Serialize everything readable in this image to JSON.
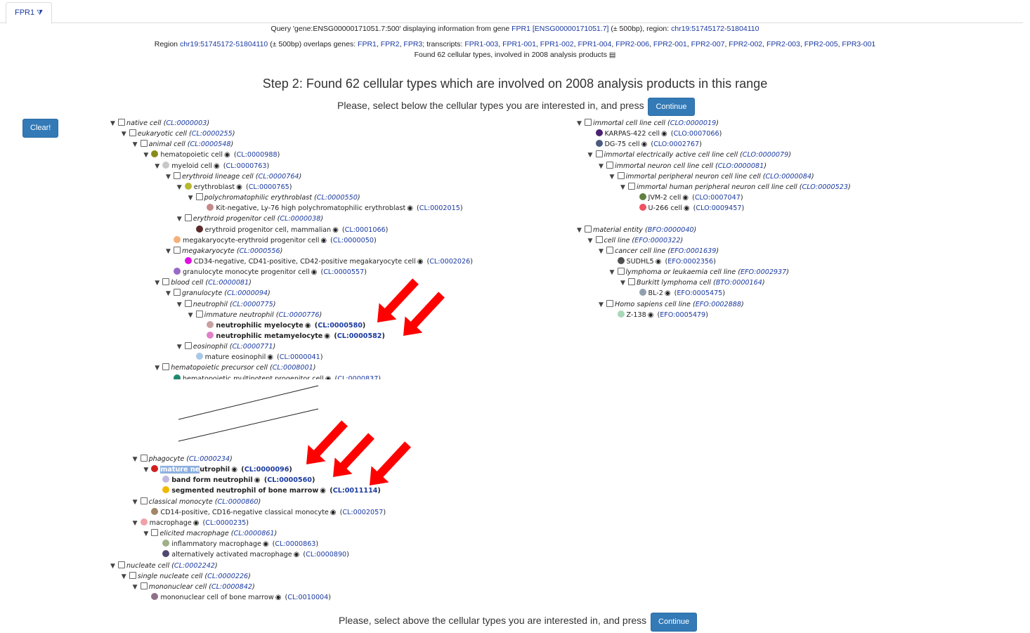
{
  "tab": {
    "label": "FPR1",
    "icon": "filter-icon"
  },
  "header": {
    "line1": {
      "prefix": "Query 'gene:ENSG00000171051.7:500' displaying information from gene ",
      "gene": "FPR1 [ENSG00000171051.7]",
      "mid": " (± 500bp), region: ",
      "region": "chr19:51745172-51804110"
    },
    "line2": {
      "prefix": "Region ",
      "region": "chr19:51745172-51804110",
      "mid": " (± 500bp) overlaps genes: ",
      "genes": [
        "FPR1",
        "FPR2",
        "FPR3"
      ],
      "tlabel": "; transcripts: ",
      "transcripts": [
        "FPR1-003",
        "FPR1-001",
        "FPR1-002",
        "FPR1-004",
        "FPR2-006",
        "FPR2-001",
        "FPR2-007",
        "FPR2-002",
        "FPR2-003",
        "FPR2-005",
        "FPR3-001"
      ]
    },
    "line3": "Found 62 cellular types, involved in 2008 analysis products"
  },
  "step_title": "Step 2: Found 62 cellular types which are involved on 2008 analysis products in this range",
  "top_prompt": "Please, select below the cellular types you are interested in, and press",
  "bottom_prompt": "Please, select above the cellular types you are interested in, and press",
  "continue_label": "Continue",
  "clear_label": "Clear!",
  "tree_left_top": [
    {
      "d": 0,
      "tri": true,
      "cb": true,
      "name": "native cell",
      "id": "CL:0000003",
      "style": "it"
    },
    {
      "d": 1,
      "tri": true,
      "cb": true,
      "name": "eukaryotic cell",
      "id": "CL:0000255",
      "style": "it"
    },
    {
      "d": 2,
      "tri": true,
      "cb": true,
      "name": "animal cell",
      "id": "CL:0000548",
      "style": "it"
    },
    {
      "d": 3,
      "tri": true,
      "dot": "#8a8a1a",
      "name": "hematopoietic cell",
      "id": "CL:0000988",
      "eye": true
    },
    {
      "d": 4,
      "tri": true,
      "dot": "#c8c8c8",
      "name": "myeloid cell",
      "id": "CL:0000763",
      "eye": true
    },
    {
      "d": 5,
      "tri": true,
      "cb": true,
      "name": "erythroid lineage cell",
      "id": "CL:0000764",
      "style": "it"
    },
    {
      "d": 6,
      "tri": true,
      "dot": "#b8b830",
      "name": "erythroblast",
      "id": "CL:0000765",
      "eye": true
    },
    {
      "d": 7,
      "tri": true,
      "cb": true,
      "name": "polychromatophilic erythroblast",
      "id": "CL:0000550",
      "style": "it"
    },
    {
      "d": 8,
      "dot": "#c48a8a",
      "name": "Kit-negative, Ly-76 high polychromatophilic erythroblast",
      "id": "CL:0002015",
      "eye": true
    },
    {
      "d": 6,
      "tri": true,
      "cb": true,
      "name": "erythroid progenitor cell",
      "id": "CL:0000038",
      "style": "it"
    },
    {
      "d": 7,
      "dot": "#5a2a2a",
      "name": "erythroid progenitor cell, mammalian",
      "id": "CL:0001066",
      "eye": true
    },
    {
      "d": 5,
      "dot": "#f5b07a",
      "name": "megakaryocyte-erythroid progenitor cell",
      "id": "CL:0000050",
      "eye": true
    },
    {
      "d": 5,
      "tri": true,
      "cb": true,
      "name": "megakaryocyte",
      "id": "CL:0000556",
      "style": "it"
    },
    {
      "d": 6,
      "dot": "#e010e0",
      "name": "CD34-negative, CD41-positive, CD42-positive megakaryocyte cell",
      "id": "CL:0002026",
      "eye": true
    },
    {
      "d": 5,
      "dot": "#9a6ac8",
      "name": "granulocyte monocyte progenitor cell",
      "id": "CL:0000557",
      "eye": true
    },
    {
      "d": 4,
      "tri": true,
      "cb": true,
      "name": "blood cell",
      "id": "CL:0000081",
      "style": "it"
    },
    {
      "d": 5,
      "tri": true,
      "cb": true,
      "name": "granulocyte",
      "id": "CL:0000094",
      "style": "it"
    },
    {
      "d": 6,
      "tri": true,
      "cb": true,
      "name": "neutrophil",
      "id": "CL:0000775",
      "style": "it"
    },
    {
      "d": 7,
      "tri": true,
      "cb": true,
      "name": "immature neutrophil",
      "id": "CL:0000776",
      "style": "it"
    },
    {
      "d": 8,
      "dot": "#c8a0a0",
      "name": "neutrophilic myelocyte",
      "id": "CL:0000580",
      "eye": true,
      "style": "b"
    },
    {
      "d": 8,
      "dot": "#e080c8",
      "name": "neutrophilic metamyelocyte",
      "id": "CL:0000582",
      "eye": true,
      "style": "b"
    },
    {
      "d": 6,
      "tri": true,
      "cb": true,
      "name": "eosinophil",
      "id": "CL:0000771",
      "style": "it"
    },
    {
      "d": 7,
      "dot": "#a8c8e8",
      "name": "mature eosinophil",
      "id": "CL:0000041",
      "eye": true
    },
    {
      "d": 4,
      "tri": true,
      "cb": true,
      "name": "hematopoietic precursor cell",
      "id": "CL:0008001",
      "style": "it"
    },
    {
      "d": 5,
      "dot": "#208870",
      "name": "hematopoietic multipotent progenitor cell",
      "id": "CL:0000837",
      "eye": true
    }
  ],
  "tree_left_bottom": [
    {
      "d": 2,
      "tri": true,
      "cb": true,
      "name": "phagocyte",
      "id": "CL:0000234",
      "style": "it"
    },
    {
      "d": 3,
      "tri": true,
      "dot": "#d02020",
      "name": "mature neutrophil",
      "sel": "mature ne",
      "id": "CL:0000096",
      "eye": true,
      "style": "b"
    },
    {
      "d": 4,
      "dot": "#c0b8e0",
      "name": "band form neutrophil",
      "id": "CL:0000560",
      "eye": true,
      "style": "b"
    },
    {
      "d": 4,
      "dot": "#f0b800",
      "name": "segmented neutrophil of bone marrow",
      "id": "CL:0011114",
      "eye": true,
      "style": "b"
    },
    {
      "d": 2,
      "tri": true,
      "cb": true,
      "name": "classical monocyte",
      "id": "CL:0000860",
      "style": "it"
    },
    {
      "d": 3,
      "dot": "#a08868",
      "name": "CD14-positive, CD16-negative classical monocyte",
      "id": "CL:0002057",
      "eye": true
    },
    {
      "d": 2,
      "tri": true,
      "dot": "#f0a0a8",
      "name": "macrophage",
      "id": "CL:0000235",
      "eye": true
    },
    {
      "d": 3,
      "tri": true,
      "cb": true,
      "name": "elicited macrophage",
      "id": "CL:0000861",
      "style": "it"
    },
    {
      "d": 4,
      "dot": "#a0b088",
      "name": "inflammatory macrophage",
      "id": "CL:0000863",
      "eye": true
    },
    {
      "d": 4,
      "dot": "#504870",
      "name": "alternatively activated macrophage",
      "id": "CL:0000890",
      "eye": true
    },
    {
      "d": 0,
      "tri": true,
      "cb": true,
      "name": "nucleate cell",
      "id": "CL:0002242",
      "style": "it"
    },
    {
      "d": 1,
      "tri": true,
      "cb": true,
      "name": "single nucleate cell",
      "id": "CL:0000226",
      "style": "it"
    },
    {
      "d": 2,
      "tri": true,
      "cb": true,
      "name": "mononuclear cell",
      "id": "CL:0000842",
      "style": "it"
    },
    {
      "d": 3,
      "dot": "#907088",
      "name": "mononuclear cell of bone marrow",
      "id": "CL:0010004",
      "eye": true
    }
  ],
  "tree_right": [
    {
      "d": 0,
      "tri": true,
      "cb": true,
      "name": "immortal cell line cell",
      "id": "CLO:0000019",
      "style": "it"
    },
    {
      "d": 1,
      "dot": "#4a2070",
      "name": "KARPAS-422 cell",
      "id": "CLO:0007066",
      "eye": true
    },
    {
      "d": 1,
      "dot": "#4a5a80",
      "name": "DG-75 cell",
      "id": "CLO:0002767",
      "eye": true
    },
    {
      "d": 1,
      "tri": true,
      "cb": true,
      "name": "immortal electrically active cell line cell",
      "id": "CLO:0000079",
      "style": "it"
    },
    {
      "d": 2,
      "tri": true,
      "cb": true,
      "name": "immortal neuron cell line cell",
      "id": "CLO:0000081",
      "style": "it"
    },
    {
      "d": 3,
      "tri": true,
      "cb": true,
      "name": "immortal peripheral neuron cell line cell",
      "id": "CLO:0000084",
      "style": "it"
    },
    {
      "d": 4,
      "tri": true,
      "cb": true,
      "name": "immortal human peripheral neuron cell line cell",
      "id": "CLO:0000523",
      "style": "it"
    },
    {
      "d": 5,
      "dot": "#608040",
      "name": "JVM-2 cell",
      "id": "CLO:0007047",
      "eye": true
    },
    {
      "d": 5,
      "dot": "#f05060",
      "name": "U-266 cell",
      "id": "CLO:0009457",
      "eye": true
    },
    {
      "gap": true
    },
    {
      "d": 0,
      "tri": true,
      "cb": true,
      "name": "material entity",
      "id": "BFO:0000040",
      "style": "it"
    },
    {
      "d": 1,
      "tri": true,
      "cb": true,
      "name": "cell line",
      "id": "EFO:0000322",
      "style": "it"
    },
    {
      "d": 2,
      "tri": true,
      "cb": true,
      "name": "cancer cell line",
      "id": "EFO:0001639",
      "style": "it"
    },
    {
      "d": 3,
      "dot": "#505050",
      "name": "SUDHL5",
      "id": "EFO:0002356",
      "eye": true
    },
    {
      "d": 3,
      "tri": true,
      "cb": true,
      "name": "lymphoma or leukaemia cell line",
      "id": "EFO:0002937",
      "style": "it"
    },
    {
      "d": 4,
      "tri": true,
      "cb": true,
      "name": "Burkitt lymphoma cell",
      "id": "BTO:0000164",
      "style": "it"
    },
    {
      "d": 5,
      "dot": "#90a0b0",
      "name": "BL-2",
      "id": "EFO:0005475",
      "eye": true
    },
    {
      "d": 2,
      "tri": true,
      "cb": true,
      "name": "Homo sapiens cell line",
      "id": "EFO:0002888",
      "style": "it"
    },
    {
      "d": 3,
      "dot": "#a8d8b8",
      "name": "Z-138",
      "id": "EFO:0005479",
      "eye": true
    }
  ],
  "colors": {
    "link": "#1a3aa0",
    "button": "#337ab7",
    "arrow": "#ff0000"
  }
}
